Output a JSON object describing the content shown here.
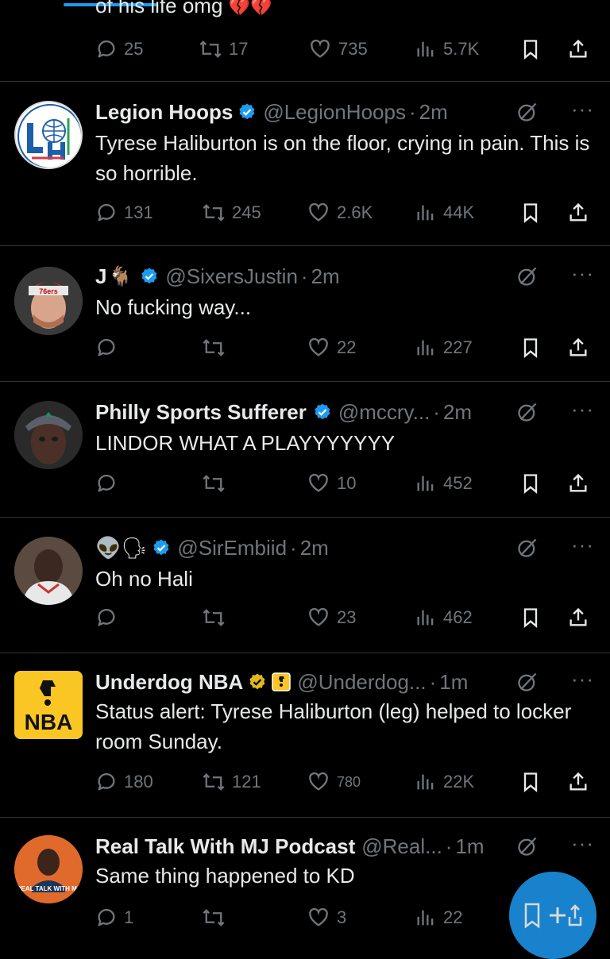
{
  "top_tweet": {
    "cutoff_text": "of his life omg",
    "actions": {
      "replies": "25",
      "reposts": "17",
      "likes": "735",
      "views": "5.7K"
    }
  },
  "tweets": [
    {
      "name": "Legion Hoops",
      "handle": "@LegionHoops",
      "time": "2m",
      "text": "Tyrese Haliburton is on the floor, crying in pain. This is so horrible.",
      "replies": "131",
      "reposts": "245",
      "likes": "2.6K",
      "views": "44K",
      "avatar_logo": "LH"
    },
    {
      "name": "J",
      "name_emoji": "🐐",
      "handle": "@SixersJustin",
      "time": "2m",
      "text": "No fucking way...",
      "replies": "",
      "reposts": "",
      "likes": "22",
      "views": "227"
    },
    {
      "name": "Philly Sports Sufferer",
      "handle": "@mccry...",
      "time": "2m",
      "text": "LINDOR WHAT A PLAYYYYYYY",
      "replies": "",
      "reposts": "",
      "likes": "10",
      "views": "452"
    },
    {
      "name_emoji": "👽🗣",
      "handle": "@SirEmbiid",
      "time": "2m",
      "text": "Oh no Hali",
      "replies": "",
      "reposts": "",
      "likes": "23",
      "views": "462"
    },
    {
      "name": "Underdog NBA",
      "handle": "@Underdog...",
      "time": "1m",
      "text": "Status alert: Tyrese Haliburton (leg) helped to locker room Sunday.",
      "replies": "180",
      "reposts": "121",
      "likes": "780",
      "views": "22K",
      "avatar_logo": "NBA"
    },
    {
      "name": "Real Talk With MJ Podcast",
      "handle": "@Real...",
      "time": "1m",
      "text": "Same thing happened to KD",
      "replies": "1",
      "reposts": "",
      "likes": "3",
      "views": "22",
      "avatar_logo": "REAL TALK WITH MJ"
    }
  ],
  "colors": {
    "accent": "#1d9bf0",
    "muted": "#71767b",
    "verified_blue": "#1d9bf0",
    "verified_gold": "#e2b719",
    "underdog_yellow": "#f9c623"
  }
}
